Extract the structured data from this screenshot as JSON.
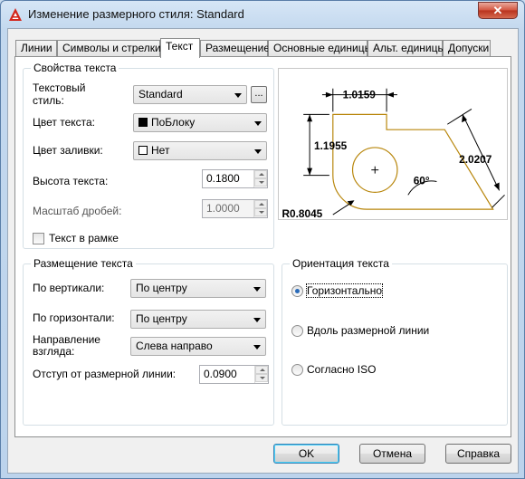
{
  "window": {
    "title": "Изменение размерного стиля: Standard",
    "close_label": "✕",
    "icon": "autocad-logo-icon"
  },
  "tabs": [
    {
      "label": "Линии"
    },
    {
      "label": "Символы и стрелки"
    },
    {
      "label": "Текст",
      "active": true
    },
    {
      "label": "Размещение"
    },
    {
      "label": "Основные единицы"
    },
    {
      "label": "Альт. единицы"
    },
    {
      "label": "Допуски"
    }
  ],
  "text_props": {
    "title": "Свойства текста",
    "style_label_1": "Текстовый",
    "style_label_2": "стиль:",
    "style_value": "Standard",
    "browse_label": "...",
    "color_label": "Цвет текста:",
    "color_value": "ПоБлоку",
    "fill_label": "Цвет заливки:",
    "fill_value": "Нет",
    "height_label": "Высота текста:",
    "height_value": "0.1800",
    "fraction_label": "Масштаб дробей:",
    "fraction_value": "1.0000",
    "frame_label": "Текст в рамке",
    "frame_checked": false
  },
  "placement": {
    "title": "Размещение текста",
    "vertical_label": "По вертикали:",
    "vertical_value": "По центру",
    "horizontal_label": "По горизонтали:",
    "horizontal_value": "По центру",
    "direction_label_1": "Направление",
    "direction_label_2": "взгляда:",
    "direction_value": "Слева направо",
    "offset_label": "Отступ от размерной линии:",
    "offset_value": "0.0900"
  },
  "orientation": {
    "title": "Ориентация текста",
    "options": [
      {
        "label": "Горизонтально",
        "checked": true
      },
      {
        "label": "Вдоль размерной линии",
        "checked": false
      },
      {
        "label": "Согласно ISO",
        "checked": false
      }
    ]
  },
  "preview": {
    "dim_top": "1.0159",
    "dim_left": "1.1955",
    "dim_right": "2.0207",
    "dim_angle": "60°",
    "dim_radius": "R0.8045",
    "shape_color": "#b8860b"
  },
  "buttons": {
    "ok": "OK",
    "cancel": "Отмена",
    "help": "Справка"
  }
}
